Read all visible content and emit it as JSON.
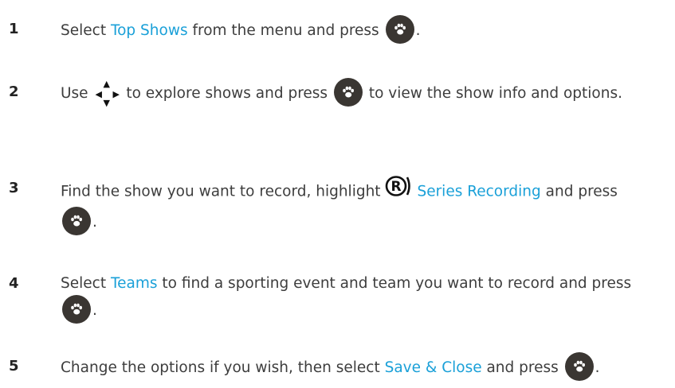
{
  "steps": [
    {
      "number": "1",
      "parts": {
        "a": "Select ",
        "b": "Top Shows",
        "c": " from the menu and press ",
        "d": "."
      }
    },
    {
      "number": "2",
      "parts": {
        "a": "Use ",
        "b": " to explore shows and press ",
        "c": " to view the show info and options."
      }
    },
    {
      "number": "3",
      "parts": {
        "a": "Find the show you want to record, highlight ",
        "b": "Series Recording",
        "c": " and press ",
        "d": "."
      }
    },
    {
      "number": "4",
      "parts": {
        "a": "Select ",
        "b": "Teams",
        "c": " to find a sporting event and team you want to record and press ",
        "d": "."
      }
    },
    {
      "number": "5",
      "parts": {
        "a": "Change the options if you wish, then select ",
        "b": "Save & Close",
        "c": " and press ",
        "d": "."
      }
    }
  ],
  "colors": {
    "highlight": "#1aa0d8",
    "text": "#3d3d3d",
    "ok_button": "#3a3632"
  },
  "icons": {
    "ok_button": "paw-icon",
    "navigation": "arrow-cluster-icon",
    "record": "r-record-icon"
  }
}
